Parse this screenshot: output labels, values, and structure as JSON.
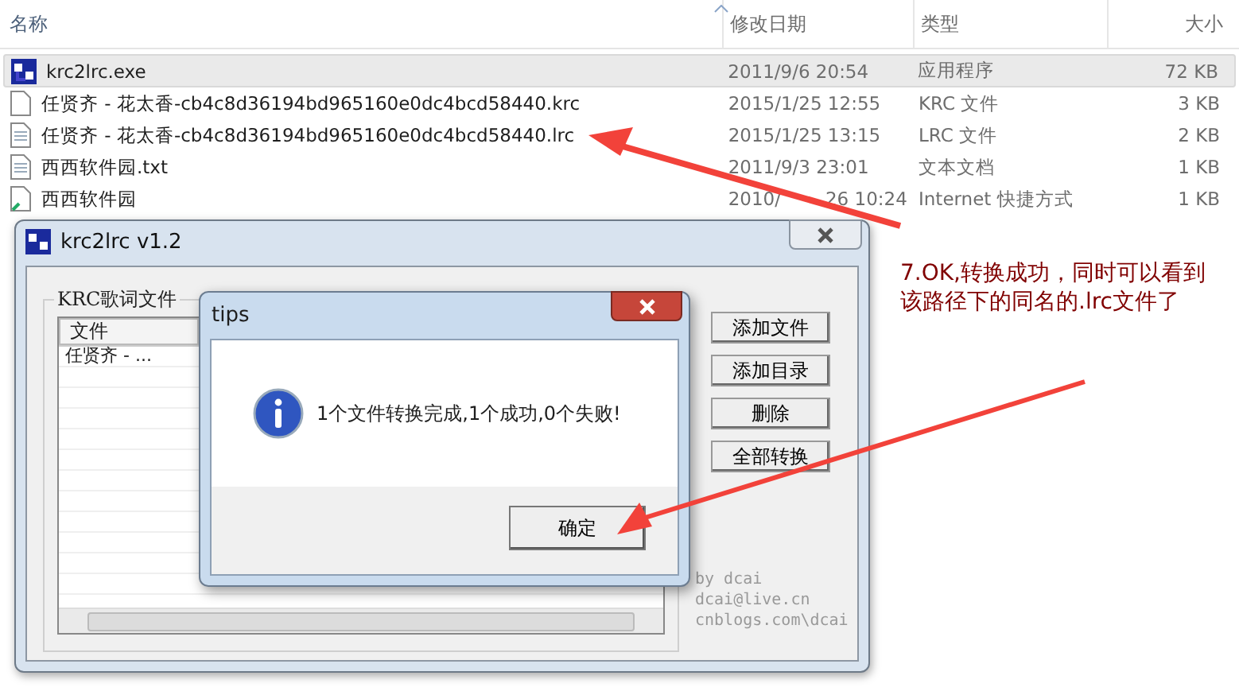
{
  "explorer": {
    "columns": [
      "名称",
      "修改日期",
      "类型",
      "大小"
    ],
    "files": [
      {
        "kind": "exe",
        "name": "krc2lrc.exe",
        "modified": [
          "2011/9/6 20:54"
        ],
        "type": "应用程序",
        "size": "72 KB",
        "selected": true
      },
      {
        "kind": "file",
        "name": "任贤齐 - 花太香-cb4c8d36194bd965160e0dc4bcd58440.krc",
        "modified": [
          "2015/1/25 12:55"
        ],
        "type": "KRC 文件",
        "size": "3 KB",
        "selected": false
      },
      {
        "kind": "doc",
        "name": "任贤齐 - 花太香-cb4c8d36194bd965160e0dc4bcd58440.lrc",
        "modified": [
          "2015/1/25 13:15"
        ],
        "type": "LRC 文件",
        "size": "2 KB",
        "selected": false
      },
      {
        "kind": "doc",
        "name": "西西软件园.txt",
        "modified": [
          "2011/9/3 23:01"
        ],
        "type": "文本文档",
        "size": "1 KB",
        "selected": false
      },
      {
        "kind": "link",
        "name": "西西软件园",
        "modified": [
          "2010/",
          "26 10:24"
        ],
        "type": "Internet 快捷方式",
        "size": "1 KB",
        "selected": false
      }
    ]
  },
  "app_window": {
    "title": "krc2lrc v1.2",
    "group_label": "KRC歌词文件",
    "list_columns": [
      "文件"
    ],
    "list_rows": [
      "任贤齐 - ..."
    ],
    "buttons": [
      "添加文件",
      "添加目录",
      "删除",
      "全部转换"
    ],
    "credits": [
      "by dcai",
      "dcai@live.cn",
      "cnblogs.com\\dcai"
    ]
  },
  "dialog": {
    "title": "tips",
    "message": "1个文件转换完成,1个成功,0个失败!",
    "button": "确定"
  },
  "annotation": "7.OK,转换成功，同时可以看到该路径下的同名的.lrc文件了"
}
